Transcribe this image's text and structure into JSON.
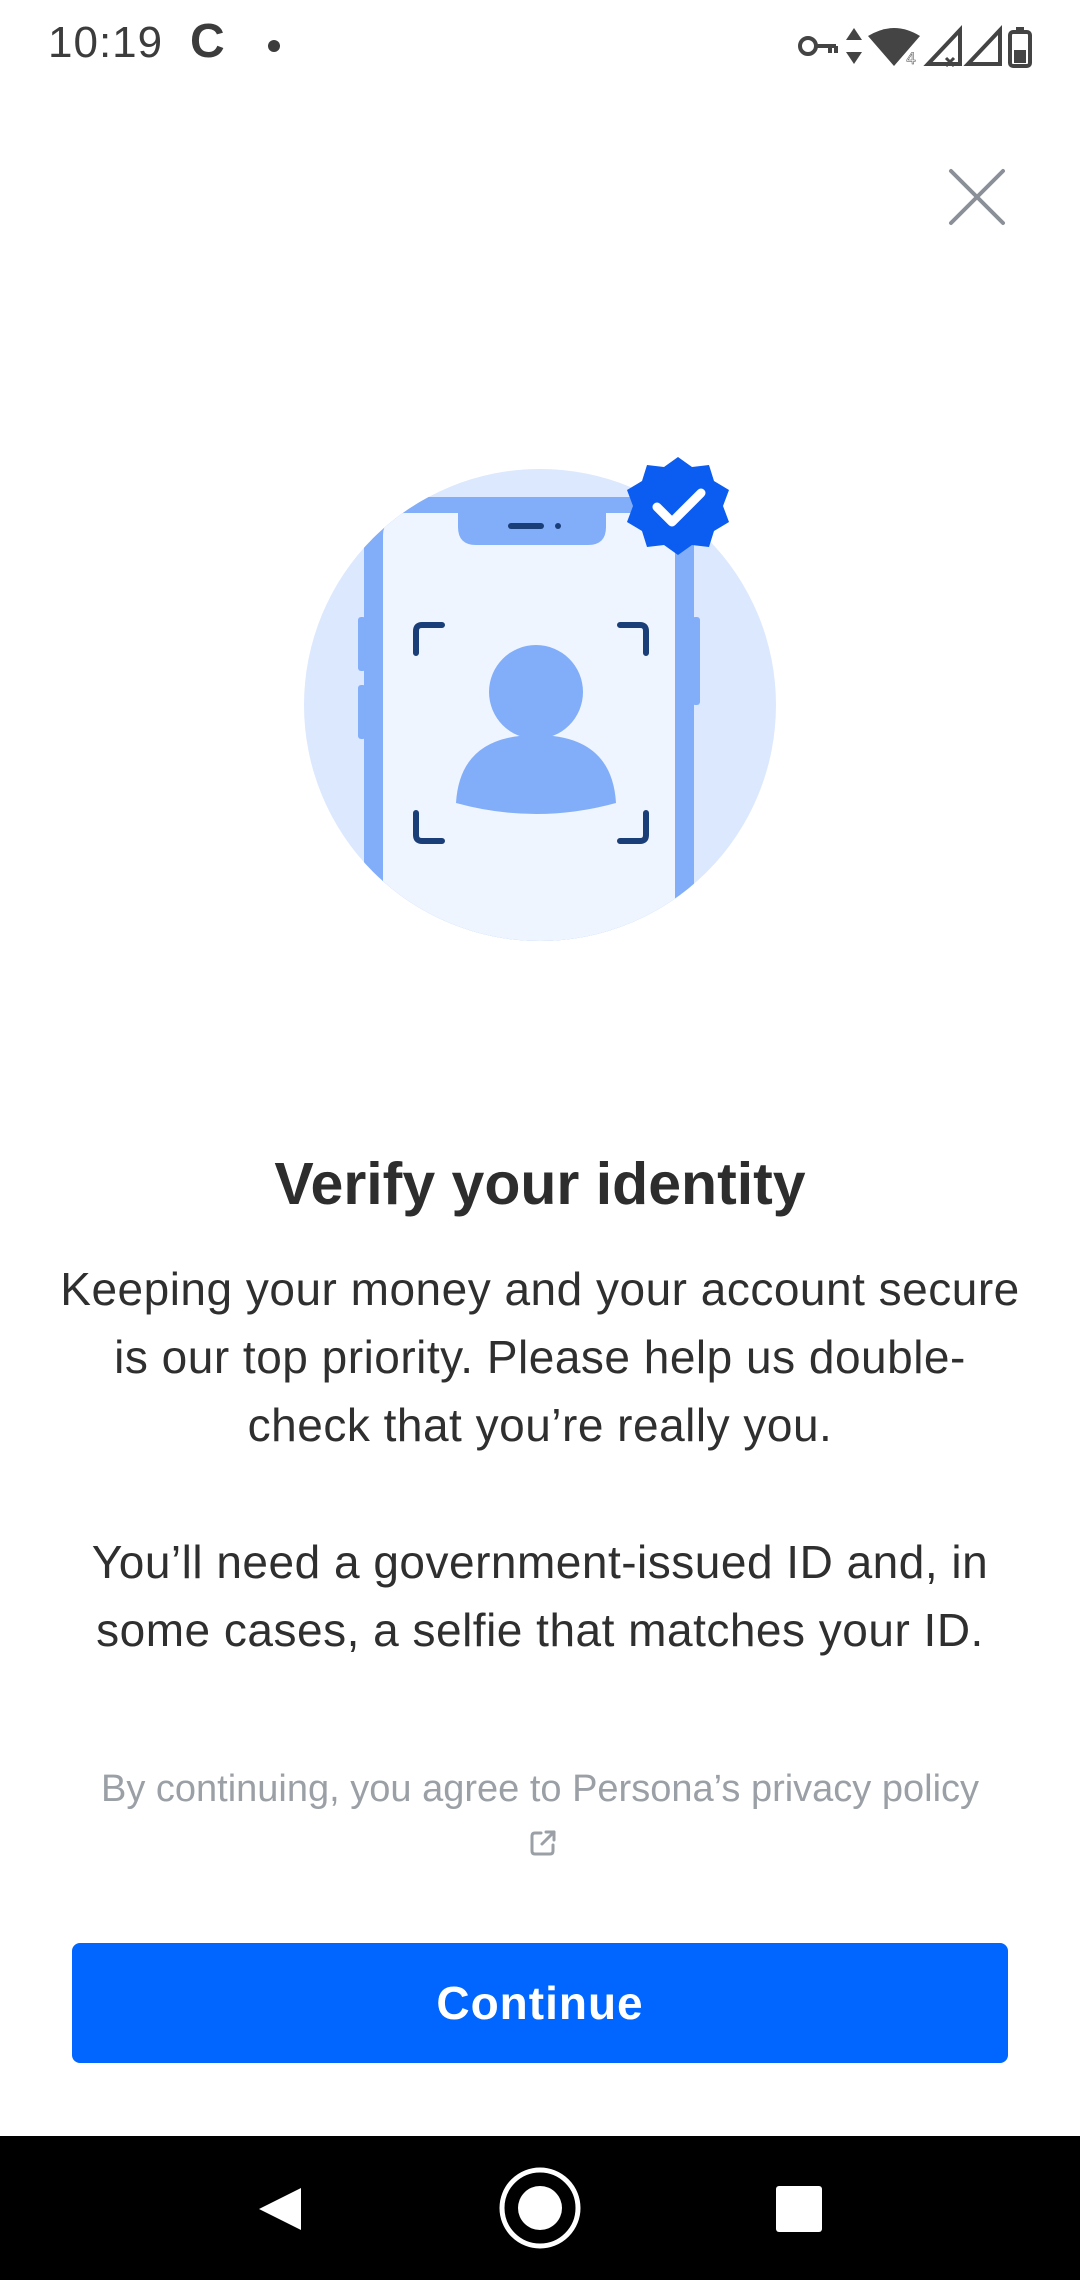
{
  "status_bar": {
    "time": "10:19",
    "app_indicator": "C",
    "icons": [
      "vpn-key-icon",
      "data-arrows-icon",
      "wifi-icon",
      "signal-icon",
      "signal-icon",
      "battery-icon"
    ],
    "wifi_badge": "4"
  },
  "dialog": {
    "close_icon": "close-icon",
    "illustration_icon": "phone-selfie-verified-icon",
    "title": "Verify your identity",
    "body_paragraph_1": "Keeping your money and your account secure is our top priority. Please help us double-check that you’re really you.",
    "body_paragraph_2": "You’ll need a government-issued ID and, in some cases, a selfie that matches your ID.",
    "fine_print_prefix": "By continuing, you agree to Persona’s",
    "privacy_link_label": "privacy policy",
    "privacy_link_icon": "external-link-icon",
    "continue_label": "Continue"
  },
  "colors": {
    "accent": "#0066ff",
    "illustration_light": "#dbe8fe",
    "illustration_mid": "#82aef9",
    "illustration_dark": "#1a3f78",
    "fine_print": "#9aa0a6"
  },
  "nav_bar": {
    "back_icon": "back-triangle-icon",
    "home_icon": "home-circle-icon",
    "recents_icon": "recents-square-icon"
  }
}
